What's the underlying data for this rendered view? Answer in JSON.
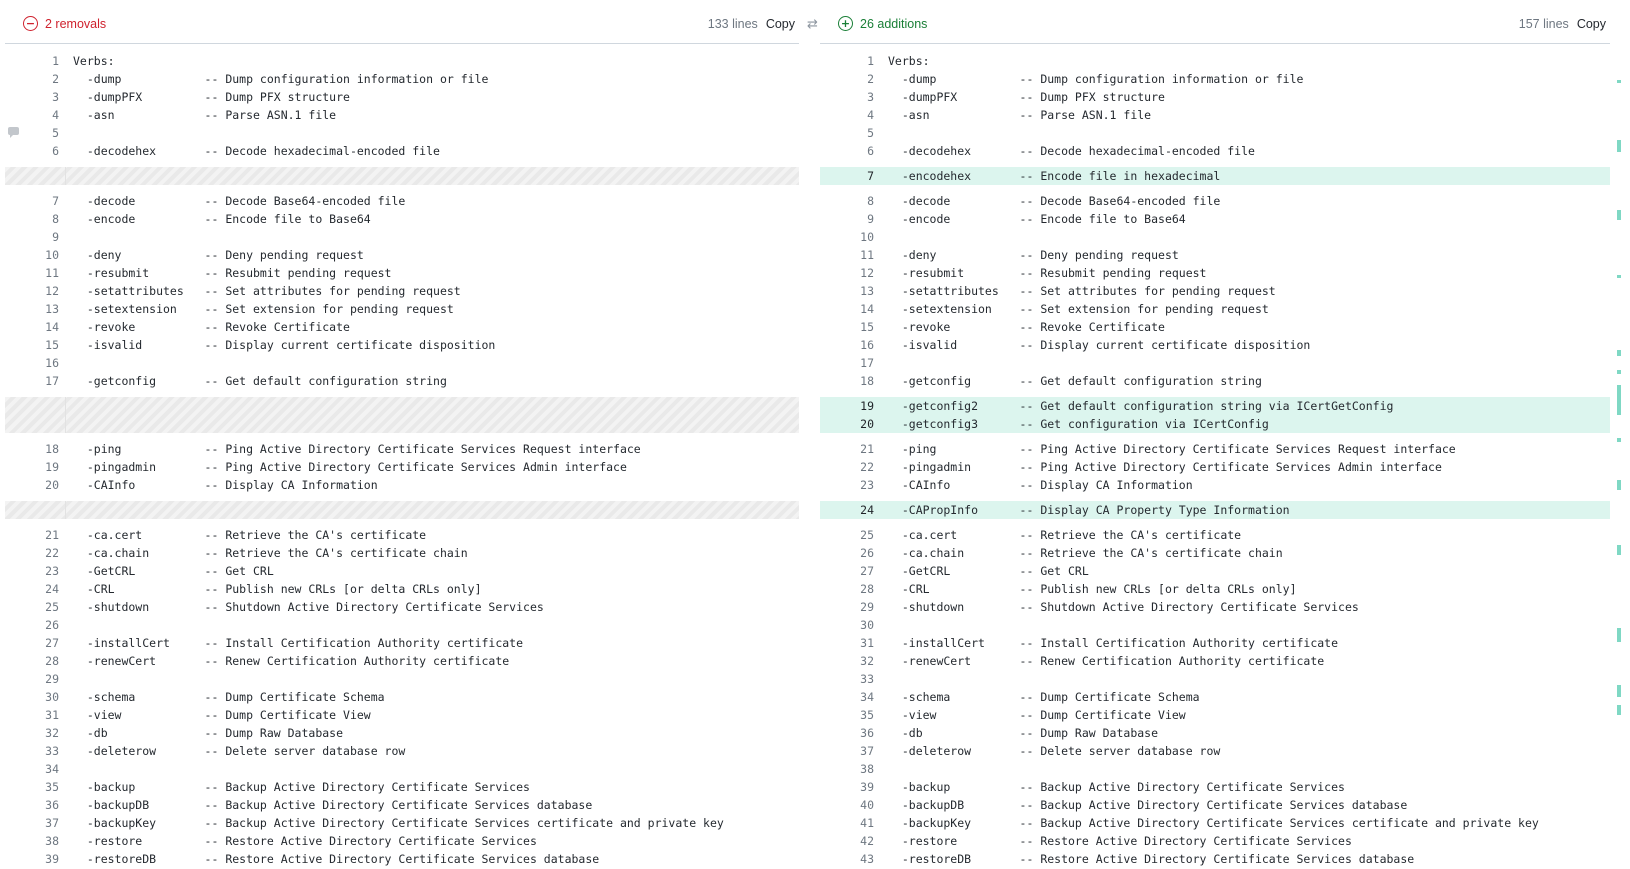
{
  "left": {
    "summary": "2 removals",
    "line_count": "133 lines",
    "copy_label": "Copy",
    "rows": [
      {
        "n": "1",
        "t": "Verbs:"
      },
      {
        "n": "2",
        "t": "  -dump            -- Dump configuration information or file"
      },
      {
        "n": "3",
        "t": "  -dumpPFX         -- Dump PFX structure"
      },
      {
        "n": "4",
        "t": "  -asn             -- Parse ASN.1 file"
      },
      {
        "n": "5",
        "t": ""
      },
      {
        "n": "6",
        "t": "  -decodehex       -- Decode hexadecimal-encoded file"
      },
      {
        "type": "gap"
      },
      {
        "type": "placeholder",
        "h": 18
      },
      {
        "type": "gap"
      },
      {
        "n": "7",
        "t": "  -decode          -- Decode Base64-encoded file"
      },
      {
        "n": "8",
        "t": "  -encode          -- Encode file to Base64"
      },
      {
        "n": "9",
        "t": ""
      },
      {
        "n": "10",
        "t": "  -deny            -- Deny pending request"
      },
      {
        "n": "11",
        "t": "  -resubmit        -- Resubmit pending request"
      },
      {
        "n": "12",
        "t": "  -setattributes   -- Set attributes for pending request"
      },
      {
        "n": "13",
        "t": "  -setextension    -- Set extension for pending request"
      },
      {
        "n": "14",
        "t": "  -revoke          -- Revoke Certificate"
      },
      {
        "n": "15",
        "t": "  -isvalid         -- Display current certificate disposition"
      },
      {
        "n": "16",
        "t": ""
      },
      {
        "n": "17",
        "t": "  -getconfig       -- Get default configuration string"
      },
      {
        "type": "gap"
      },
      {
        "type": "placeholder",
        "h": 36
      },
      {
        "type": "gap"
      },
      {
        "n": "18",
        "t": "  -ping            -- Ping Active Directory Certificate Services Request interface"
      },
      {
        "n": "19",
        "t": "  -pingadmin       -- Ping Active Directory Certificate Services Admin interface"
      },
      {
        "n": "20",
        "t": "  -CAInfo          -- Display CA Information"
      },
      {
        "type": "gap"
      },
      {
        "type": "placeholder",
        "h": 18
      },
      {
        "type": "gap"
      },
      {
        "n": "21",
        "t": "  -ca.cert         -- Retrieve the CA's certificate"
      },
      {
        "n": "22",
        "t": "  -ca.chain        -- Retrieve the CA's certificate chain"
      },
      {
        "n": "23",
        "t": "  -GetCRL          -- Get CRL"
      },
      {
        "n": "24",
        "t": "  -CRL             -- Publish new CRLs [or delta CRLs only]"
      },
      {
        "n": "25",
        "t": "  -shutdown        -- Shutdown Active Directory Certificate Services"
      },
      {
        "n": "26",
        "t": ""
      },
      {
        "n": "27",
        "t": "  -installCert     -- Install Certification Authority certificate"
      },
      {
        "n": "28",
        "t": "  -renewCert       -- Renew Certification Authority certificate"
      },
      {
        "n": "29",
        "t": ""
      },
      {
        "n": "30",
        "t": "  -schema          -- Dump Certificate Schema"
      },
      {
        "n": "31",
        "t": "  -view            -- Dump Certificate View"
      },
      {
        "n": "32",
        "t": "  -db              -- Dump Raw Database"
      },
      {
        "n": "33",
        "t": "  -deleterow       -- Delete server database row"
      },
      {
        "n": "34",
        "t": ""
      },
      {
        "n": "35",
        "t": "  -backup          -- Backup Active Directory Certificate Services"
      },
      {
        "n": "36",
        "t": "  -backupDB        -- Backup Active Directory Certificate Services database"
      },
      {
        "n": "37",
        "t": "  -backupKey       -- Backup Active Directory Certificate Services certificate and private key"
      },
      {
        "n": "38",
        "t": "  -restore         -- Restore Active Directory Certificate Services"
      },
      {
        "n": "39",
        "t": "  -restoreDB       -- Restore Active Directory Certificate Services database"
      }
    ]
  },
  "right": {
    "summary": "26 additions",
    "line_count": "157 lines",
    "copy_label": "Copy",
    "rows": [
      {
        "n": "1",
        "t": "Verbs:"
      },
      {
        "n": "2",
        "t": "  -dump            -- Dump configuration information or file"
      },
      {
        "n": "3",
        "t": "  -dumpPFX         -- Dump PFX structure"
      },
      {
        "n": "4",
        "t": "  -asn             -- Parse ASN.1 file"
      },
      {
        "n": "5",
        "t": ""
      },
      {
        "n": "6",
        "t": "  -decodehex       -- Decode hexadecimal-encoded file"
      },
      {
        "n": "7",
        "t": "  -encodehex       -- Encode file in hexadecimal",
        "type": "added",
        "first": true,
        "last": true
      },
      {
        "n": "8",
        "t": "  -decode          -- Decode Base64-encoded file"
      },
      {
        "n": "9",
        "t": "  -encode          -- Encode file to Base64"
      },
      {
        "n": "10",
        "t": ""
      },
      {
        "n": "11",
        "t": "  -deny            -- Deny pending request"
      },
      {
        "n": "12",
        "t": "  -resubmit        -- Resubmit pending request"
      },
      {
        "n": "13",
        "t": "  -setattributes   -- Set attributes for pending request"
      },
      {
        "n": "14",
        "t": "  -setextension    -- Set extension for pending request"
      },
      {
        "n": "15",
        "t": "  -revoke          -- Revoke Certificate"
      },
      {
        "n": "16",
        "t": "  -isvalid         -- Display current certificate disposition"
      },
      {
        "n": "17",
        "t": ""
      },
      {
        "n": "18",
        "t": "  -getconfig       -- Get default configuration string"
      },
      {
        "n": "19",
        "t": "  -getconfig2      -- Get default configuration string via ICertGetConfig",
        "type": "added",
        "first": true
      },
      {
        "n": "20",
        "t": "  -getconfig3      -- Get configuration via ICertConfig",
        "type": "added",
        "last": true
      },
      {
        "n": "21",
        "t": "  -ping            -- Ping Active Directory Certificate Services Request interface"
      },
      {
        "n": "22",
        "t": "  -pingadmin       -- Ping Active Directory Certificate Services Admin interface"
      },
      {
        "n": "23",
        "t": "  -CAInfo          -- Display CA Information"
      },
      {
        "n": "24",
        "t": "  -CAPropInfo      -- Display CA Property Type Information",
        "type": "added",
        "first": true,
        "last": true
      },
      {
        "n": "25",
        "t": "  -ca.cert         -- Retrieve the CA's certificate"
      },
      {
        "n": "26",
        "t": "  -ca.chain        -- Retrieve the CA's certificate chain"
      },
      {
        "n": "27",
        "t": "  -GetCRL          -- Get CRL"
      },
      {
        "n": "28",
        "t": "  -CRL             -- Publish new CRLs [or delta CRLs only]"
      },
      {
        "n": "29",
        "t": "  -shutdown        -- Shutdown Active Directory Certificate Services"
      },
      {
        "n": "30",
        "t": ""
      },
      {
        "n": "31",
        "t": "  -installCert     -- Install Certification Authority certificate"
      },
      {
        "n": "32",
        "t": "  -renewCert       -- Renew Certification Authority certificate"
      },
      {
        "n": "33",
        "t": ""
      },
      {
        "n": "34",
        "t": "  -schema          -- Dump Certificate Schema"
      },
      {
        "n": "35",
        "t": "  -view            -- Dump Certificate View"
      },
      {
        "n": "36",
        "t": "  -db              -- Dump Raw Database"
      },
      {
        "n": "37",
        "t": "  -deleterow       -- Delete server database row"
      },
      {
        "n": "38",
        "t": ""
      },
      {
        "n": "39",
        "t": "  -backup          -- Backup Active Directory Certificate Services"
      },
      {
        "n": "40",
        "t": "  -backupDB        -- Backup Active Directory Certificate Services database"
      },
      {
        "n": "41",
        "t": "  -backupKey       -- Backup Active Directory Certificate Services certificate and private key"
      },
      {
        "n": "42",
        "t": "  -restore         -- Restore Active Directory Certificate Services"
      },
      {
        "n": "43",
        "t": "  -restoreDB       -- Restore Active Directory Certificate Services database"
      }
    ]
  },
  "icons": {
    "removal": "minus-circle-icon",
    "addition": "plus-circle-icon",
    "swap": "swap-arrows-icon",
    "comment": "comment-icon"
  },
  "colors": {
    "removal": "#cf222e",
    "addition": "#1a7f37",
    "added_line_bg": "#dcf5ee",
    "minimap_mark": "#7fd8c4"
  }
}
